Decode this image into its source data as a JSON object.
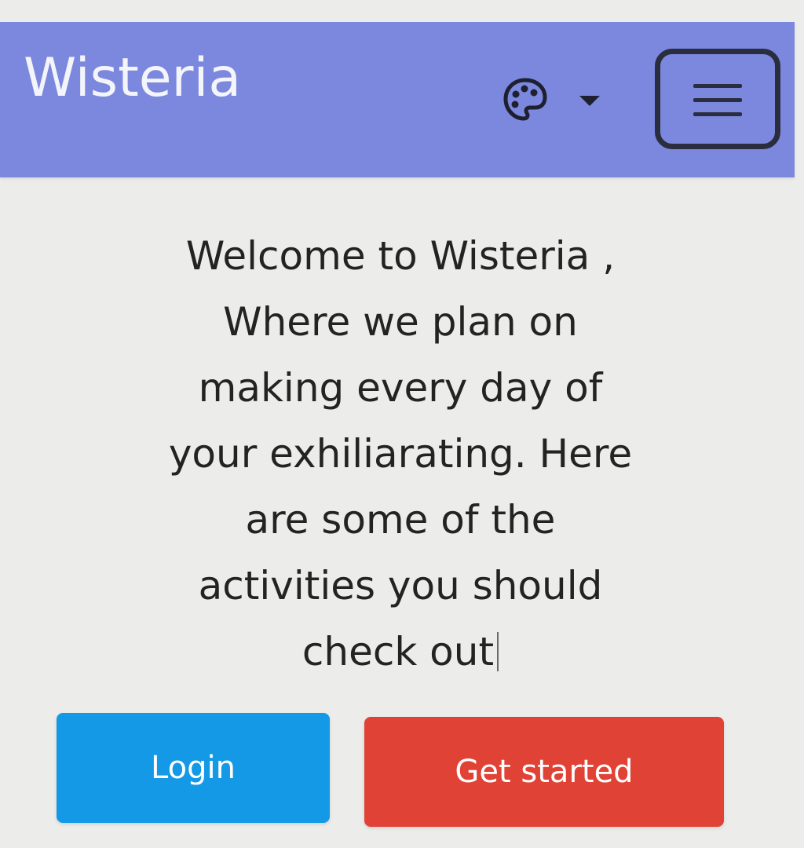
{
  "navbar": {
    "brand": "Wisteria",
    "theme_icon": "palette-icon",
    "theme_caret_icon": "caret-down-icon",
    "menu_icon": "hamburger-icon",
    "background": "#7b88de"
  },
  "hero": {
    "line1": "Welcome to Wisteria ,",
    "line2": "Where we plan on",
    "line3": "making every day of",
    "line4": "your exhiliarating. Here",
    "line5": "are some of the",
    "line6": "activities you should",
    "line7": "check out"
  },
  "actions": {
    "login_label": "Login",
    "login_color": "#1499e6",
    "get_started_label": "Get started",
    "get_started_color": "#e14236"
  }
}
